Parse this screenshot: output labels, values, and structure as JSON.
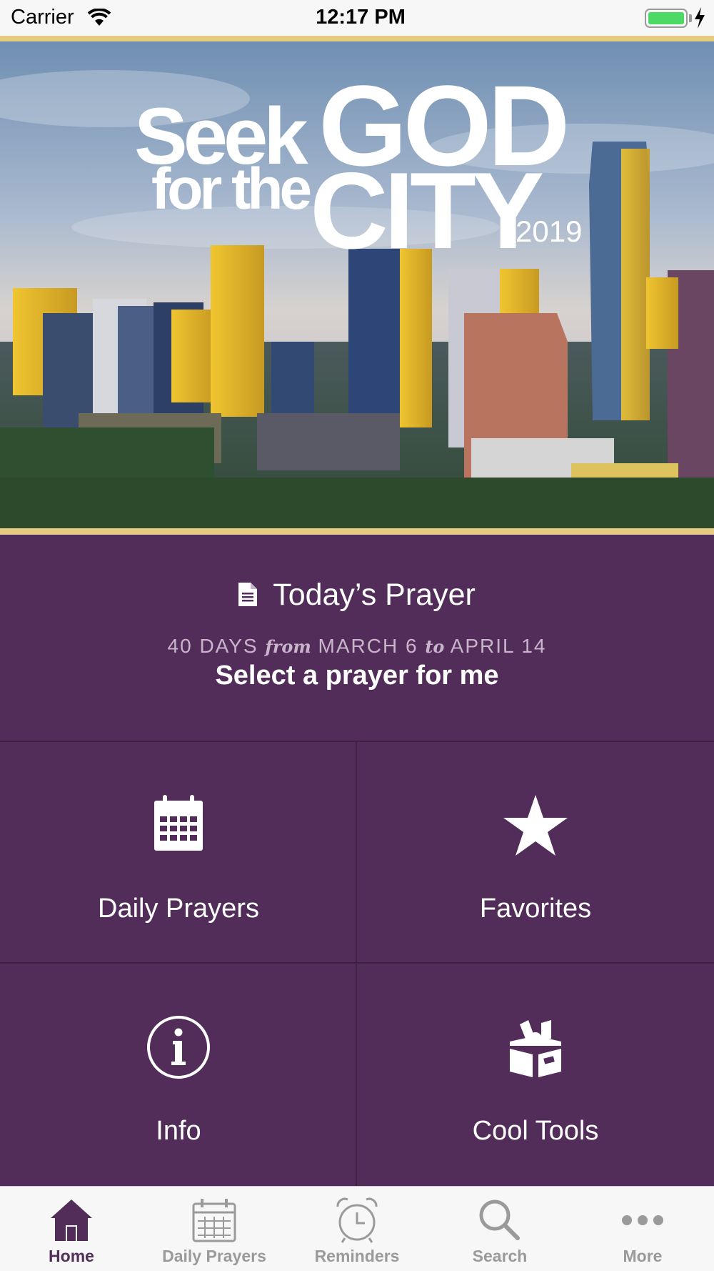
{
  "status_bar": {
    "carrier": "Carrier",
    "time": "12:17 PM"
  },
  "hero": {
    "logo": {
      "seek": "Seek",
      "god": "GOD",
      "for_the": "for the",
      "city": "CITY",
      "year": "2019"
    }
  },
  "today": {
    "title": "Today’s Prayer",
    "dates": {
      "prefix": "40 DAYS",
      "from": "from",
      "start": "MARCH 6",
      "to": "to",
      "end": "APRIL 14"
    },
    "action": "Select a prayer for me"
  },
  "grid": {
    "daily_prayers": "Daily Prayers",
    "favorites": "Favorites",
    "info": "Info",
    "cool_tools": "Cool Tools"
  },
  "tabbar": {
    "tabs": [
      {
        "label": "Home",
        "icon": "home-icon",
        "active": true
      },
      {
        "label": "Daily Prayers",
        "icon": "calendar-icon",
        "active": false
      },
      {
        "label": "Reminders",
        "icon": "alarm-clock-icon",
        "active": false
      },
      {
        "label": "Search",
        "icon": "search-icon",
        "active": false
      },
      {
        "label": "More",
        "icon": "more-icon",
        "active": false
      }
    ]
  },
  "colors": {
    "purple": "#532d59",
    "gold_border": "#e6cc83",
    "tab_active": "#532d59",
    "tab_inactive": "#9a9a9a"
  }
}
